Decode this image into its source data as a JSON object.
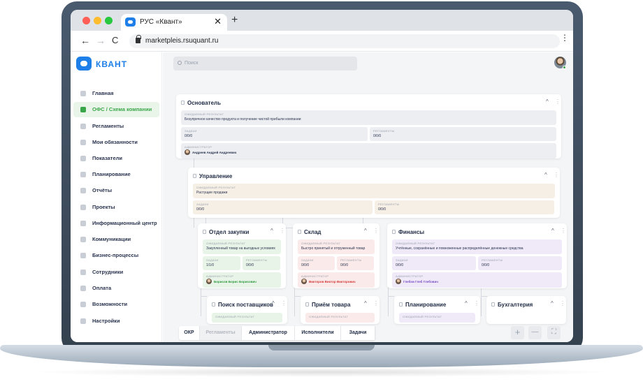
{
  "browser": {
    "tab_title": "РУС «Квант»",
    "tab_close": "✕",
    "new_tab": "+",
    "back": "←",
    "forward": "→",
    "reload": "C",
    "url": "marketpleis.rsuquant.ru",
    "menu": "⋮",
    "colors": {
      "close": "#ff5f57",
      "minimize": "#febc2e",
      "maximize": "#28c840"
    }
  },
  "brand": {
    "name": "КВАНТ",
    "color": "#1e7fe8"
  },
  "sidebar": {
    "items": [
      {
        "label": "Главная",
        "icon": "home-icon",
        "active": false
      },
      {
        "label": "ОФС / Схема компании",
        "icon": "org-chart-icon",
        "active": true
      },
      {
        "label": "Регламенты",
        "icon": "document-icon",
        "active": false
      },
      {
        "label": "Мои обязанности",
        "icon": "folder-icon",
        "active": false
      },
      {
        "label": "Показатели",
        "icon": "shield-icon",
        "active": false
      },
      {
        "label": "Планирование",
        "icon": "clock-icon",
        "active": false
      },
      {
        "label": "Отчёты",
        "icon": "report-icon",
        "active": false
      },
      {
        "label": "Проекты",
        "icon": "cloud-icon",
        "active": false
      },
      {
        "label": "Информационный центр",
        "icon": "info-icon",
        "active": false
      },
      {
        "label": "Коммуникации",
        "icon": "chat-icon",
        "active": false
      },
      {
        "label": "Бизнес-процессы",
        "icon": "process-icon",
        "active": false
      },
      {
        "label": "Сотрудники",
        "icon": "users-icon",
        "active": false
      },
      {
        "label": "Оплата",
        "icon": "card-icon",
        "active": false
      },
      {
        "label": "Возможности",
        "icon": "flag-icon",
        "active": false
      },
      {
        "label": "Настройки",
        "icon": "gear-icon",
        "active": false
      }
    ],
    "active_color": "#3aa64a"
  },
  "search": {
    "placeholder": "Поиск"
  },
  "labels": {
    "result": "ОЖИДАЕМЫЙ РЕЗУЛЬТАТ",
    "tasks": "ЗАДАЧИ",
    "regs": "РЕГЛАМЕНТЫ",
    "admin": "АДМИНИСТРАТОР",
    "chev": "^",
    "kebab": "⋮"
  },
  "cards": {
    "founder": {
      "title": "Основатель",
      "result": "Безупречное качество продукта и получение чистой прибыли компании",
      "tasks": "0/0/0",
      "regs": "0/0/0",
      "admin": "Андреев Андрей Андреевич"
    },
    "management": {
      "title": "Управление",
      "result": "Растущие продажи",
      "tasks": "0/0/0",
      "regs": "0/0/0"
    },
    "purchasing": {
      "title": "Отдел закупки",
      "result": "Закупленный товар на выгодных условиях",
      "tasks": "1/1/0",
      "regs": "0/0/0",
      "admin": "Борисов Борис Борисович",
      "color": "#e8f4e8",
      "admin_color": "#2f9a3f"
    },
    "warehouse": {
      "title": "Склад",
      "result": "Быстро принятый и отгруженный товар",
      "tasks": "0/0/0",
      "regs": "0/0/0",
      "admin": "Викторов Виктор Викторович",
      "color": "#fbeaea",
      "admin_color": "#d43a3a"
    },
    "finance": {
      "title": "Финансы",
      "result": "Учтённые, сохранённые и помноженные распределённые денежные средства",
      "tasks": "0/0/0",
      "regs": "0/0/0",
      "admin": "Глебов Глеб Глебович",
      "color": "#efe9f8",
      "admin_color": "#7b4fc7"
    },
    "supplier_search": {
      "title": "Поиск поставщиков",
      "result": "ОЖИДАЕМЫЙ РЕЗУЛЬТАТ"
    },
    "goods_receipt": {
      "title": "Приём товара",
      "result": "ОЖИДАЕМЫЙ РЕЗУЛЬТАТ"
    },
    "planning": {
      "title": "Планирование",
      "result": "ОЖИДАЕМЫЙ РЕЗУЛЬТАТ"
    },
    "accounting": {
      "title": "Бухгалтерия"
    }
  },
  "bottom_tabs": [
    {
      "label": "ОКР",
      "muted": false
    },
    {
      "label": "Регламенты",
      "muted": true
    },
    {
      "label": "Администратор",
      "muted": false
    },
    {
      "label": "Исполнители",
      "muted": false
    },
    {
      "label": "Задачи",
      "muted": false
    }
  ],
  "zoom": {
    "plus": "+",
    "minus": "—",
    "fit": "⛶"
  }
}
